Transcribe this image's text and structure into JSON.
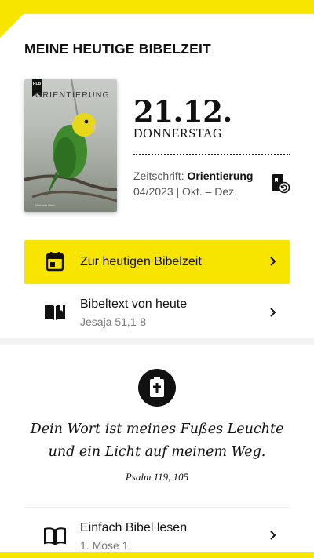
{
  "page": {
    "title": "MEINE HEUTIGE BIBELZEIT"
  },
  "cover": {
    "title": "ORIENTIERUNG",
    "badge": "RLB",
    "subtitle": "Gott das Wort"
  },
  "today": {
    "date": "21.12.",
    "weekday": "DONNERSTAG"
  },
  "magazine": {
    "prefix": "Zeitschrift: ",
    "name": "Orientierung",
    "issue": "04/2023 | Okt. – Dez."
  },
  "actions": {
    "primary": {
      "label": "Zur heutigen Bibelzeit"
    },
    "bibletext": {
      "label": "Bibeltext von heute",
      "sub": "Jesaja 51,1-8"
    }
  },
  "verse": {
    "line1": "Dein Wort ist meines Fußes Leuchte",
    "line2": "und ein Licht auf meinem Weg.",
    "reference": "Psalm 119, 105"
  },
  "readbible": {
    "label": "Einfach Bibel lesen",
    "sub": "1. Mose 1"
  },
  "colors": {
    "accent": "#f7e500",
    "text": "#111111"
  }
}
